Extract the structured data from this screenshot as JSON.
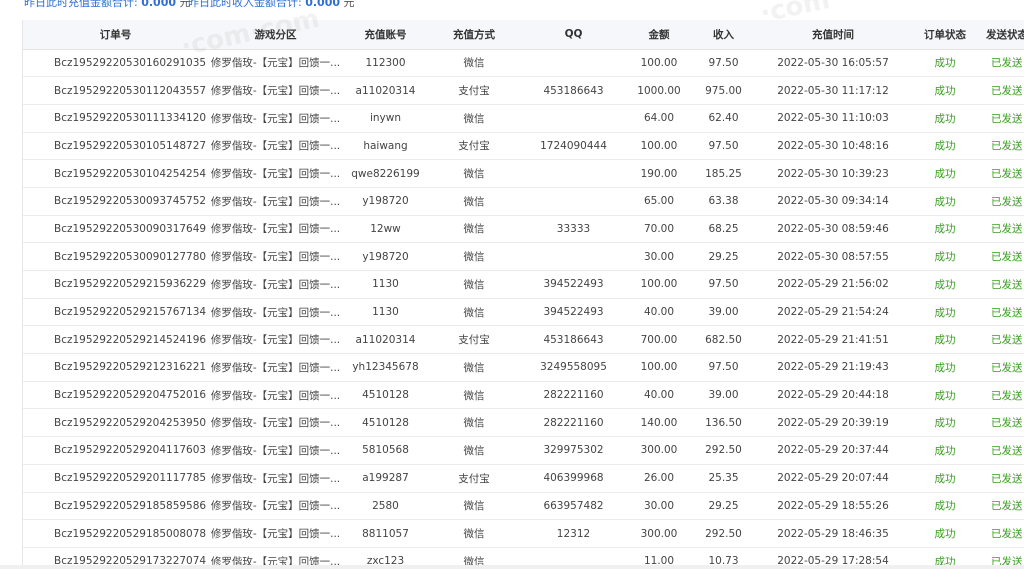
{
  "summary": {
    "recharge_label": "昨日此时充值金额合计:",
    "recharge_value": "0.000",
    "recharge_unit": "元",
    "income_label": "昨日此时收入金额合计:",
    "income_value": "0.000",
    "income_unit": "元"
  },
  "table": {
    "headers": {
      "order_no": "订单号",
      "game_zone": "游戏分区",
      "account": "充值账号",
      "method": "充值方式",
      "qq": "QQ",
      "amount": "金额",
      "income": "收入",
      "time": "充值时间",
      "status": "订单状态",
      "send": "发送状态"
    },
    "rows": [
      {
        "order_no": "Bcz19529220530160291035",
        "game_zone": "修罗偕玫-【元宝】回馈一...",
        "account": "112300",
        "method": "微信",
        "qq": "",
        "amount": "100.00",
        "income": "97.50",
        "time": "2022-05-30 16:05:57",
        "status": "成功",
        "send": "已发送"
      },
      {
        "order_no": "Bcz19529220530112043557",
        "game_zone": "修罗偕玫-【元宝】回馈一...",
        "account": "a11020314",
        "method": "支付宝",
        "qq": "453186643",
        "amount": "1000.00",
        "income": "975.00",
        "time": "2022-05-30 11:17:12",
        "status": "成功",
        "send": "已发送"
      },
      {
        "order_no": "Bcz19529220530111334120",
        "game_zone": "修罗偕玫-【元宝】回馈一...",
        "account": "inywn",
        "method": "微信",
        "qq": "",
        "amount": "64.00",
        "income": "62.40",
        "time": "2022-05-30 11:10:03",
        "status": "成功",
        "send": "已发送"
      },
      {
        "order_no": "Bcz19529220530105148727",
        "game_zone": "修罗偕玫-【元宝】回馈一...",
        "account": "haiwang",
        "method": "支付宝",
        "qq": "1724090444",
        "amount": "100.00",
        "income": "97.50",
        "time": "2022-05-30 10:48:16",
        "status": "成功",
        "send": "已发送"
      },
      {
        "order_no": "Bcz19529220530104254254",
        "game_zone": "修罗偕玫-【元宝】回馈一...",
        "account": "qwe8226199",
        "method": "微信",
        "qq": "",
        "amount": "190.00",
        "income": "185.25",
        "time": "2022-05-30 10:39:23",
        "status": "成功",
        "send": "已发送"
      },
      {
        "order_no": "Bcz19529220530093745752",
        "game_zone": "修罗偕玫-【元宝】回馈一...",
        "account": "y198720",
        "method": "微信",
        "qq": "",
        "amount": "65.00",
        "income": "63.38",
        "time": "2022-05-30 09:34:14",
        "status": "成功",
        "send": "已发送"
      },
      {
        "order_no": "Bcz19529220530090317649",
        "game_zone": "修罗偕玫-【元宝】回馈一...",
        "account": "12ww",
        "method": "微信",
        "qq": "33333",
        "amount": "70.00",
        "income": "68.25",
        "time": "2022-05-30 08:59:46",
        "status": "成功",
        "send": "已发送"
      },
      {
        "order_no": "Bcz19529220530090127780",
        "game_zone": "修罗偕玫-【元宝】回馈一...",
        "account": "y198720",
        "method": "微信",
        "qq": "",
        "amount": "30.00",
        "income": "29.25",
        "time": "2022-05-30 08:57:55",
        "status": "成功",
        "send": "已发送"
      },
      {
        "order_no": "Bcz19529220529215936229",
        "game_zone": "修罗偕玫-【元宝】回馈一...",
        "account": "1130",
        "method": "微信",
        "qq": "394522493",
        "amount": "100.00",
        "income": "97.50",
        "time": "2022-05-29 21:56:02",
        "status": "成功",
        "send": "已发送"
      },
      {
        "order_no": "Bcz19529220529215767134",
        "game_zone": "修罗偕玫-【元宝】回馈一...",
        "account": "1130",
        "method": "微信",
        "qq": "394522493",
        "amount": "40.00",
        "income": "39.00",
        "time": "2022-05-29 21:54:24",
        "status": "成功",
        "send": "已发送"
      },
      {
        "order_no": "Bcz19529220529214524196",
        "game_zone": "修罗偕玫-【元宝】回馈一...",
        "account": "a11020314",
        "method": "支付宝",
        "qq": "453186643",
        "amount": "700.00",
        "income": "682.50",
        "time": "2022-05-29 21:41:51",
        "status": "成功",
        "send": "已发送"
      },
      {
        "order_no": "Bcz19529220529212316221",
        "game_zone": "修罗偕玫-【元宝】回馈一...",
        "account": "yh12345678",
        "method": "微信",
        "qq": "3249558095",
        "amount": "100.00",
        "income": "97.50",
        "time": "2022-05-29 21:19:43",
        "status": "成功",
        "send": "已发送"
      },
      {
        "order_no": "Bcz19529220529204752016",
        "game_zone": "修罗偕玫-【元宝】回馈一...",
        "account": "4510128",
        "method": "微信",
        "qq": "282221160",
        "amount": "40.00",
        "income": "39.00",
        "time": "2022-05-29 20:44:18",
        "status": "成功",
        "send": "已发送"
      },
      {
        "order_no": "Bcz19529220529204253950",
        "game_zone": "修罗偕玫-【元宝】回馈一...",
        "account": "4510128",
        "method": "微信",
        "qq": "282221160",
        "amount": "140.00",
        "income": "136.50",
        "time": "2022-05-29 20:39:19",
        "status": "成功",
        "send": "已发送"
      },
      {
        "order_no": "Bcz19529220529204117603",
        "game_zone": "修罗偕玫-【元宝】回馈一...",
        "account": "5810568",
        "method": "微信",
        "qq": "329975302",
        "amount": "300.00",
        "income": "292.50",
        "time": "2022-05-29 20:37:44",
        "status": "成功",
        "send": "已发送"
      },
      {
        "order_no": "Bcz19529220529201117785",
        "game_zone": "修罗偕玫-【元宝】回馈一...",
        "account": "a199287",
        "method": "支付宝",
        "qq": "406399968",
        "amount": "26.00",
        "income": "25.35",
        "time": "2022-05-29 20:07:44",
        "status": "成功",
        "send": "已发送"
      },
      {
        "order_no": "Bcz19529220529185859586",
        "game_zone": "修罗偕玫-【元宝】回馈一...",
        "account": "2580",
        "method": "微信",
        "qq": "663957482",
        "amount": "30.00",
        "income": "29.25",
        "time": "2022-05-29 18:55:26",
        "status": "成功",
        "send": "已发送"
      },
      {
        "order_no": "Bcz19529220529185008078",
        "game_zone": "修罗偕玫-【元宝】回馈一...",
        "account": "8811057",
        "method": "微信",
        "qq": "12312",
        "amount": "300.00",
        "income": "292.50",
        "time": "2022-05-29 18:46:35",
        "status": "成功",
        "send": "已发送"
      },
      {
        "order_no": "Bcz19529220529173227074",
        "game_zone": "修罗偕玫-【元宝】回馈一...",
        "account": "zxc123",
        "method": "微信",
        "qq": "",
        "amount": "11.00",
        "income": "10.73",
        "time": "2022-05-29 17:28:54",
        "status": "成功",
        "send": "已发送"
      }
    ]
  },
  "colors": {
    "accent": "#2f6fd3",
    "success": "#3a9d22",
    "header_bg": "#f5f7fa"
  }
}
